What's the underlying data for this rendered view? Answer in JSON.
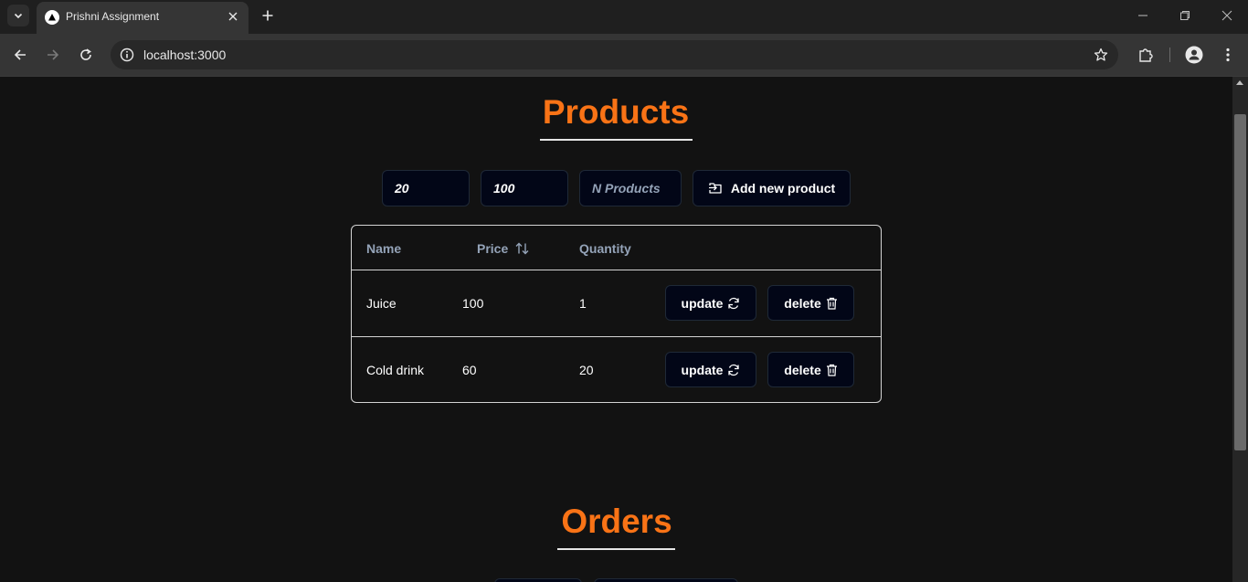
{
  "browser": {
    "tab_title": "Prishni Assignment",
    "url": "localhost:3000"
  },
  "products": {
    "title": "Products",
    "min_price_value": "20",
    "max_price_value": "100",
    "count_placeholder": "N Products",
    "add_button_label": "Add new product",
    "table": {
      "headers": {
        "name": "Name",
        "price": "Price",
        "quantity": "Quantity"
      },
      "rows": [
        {
          "name": "Juice",
          "price": "100",
          "quantity": "1",
          "update_label": "update",
          "delete_label": "delete"
        },
        {
          "name": "Cold drink",
          "price": "60",
          "quantity": "20",
          "update_label": "update",
          "delete_label": "delete"
        }
      ]
    }
  },
  "orders": {
    "title": "Orders"
  },
  "colors": {
    "accent": "#f97316",
    "background": "#121212",
    "button_bg": "#020617",
    "muted_text": "#94a3b8"
  }
}
